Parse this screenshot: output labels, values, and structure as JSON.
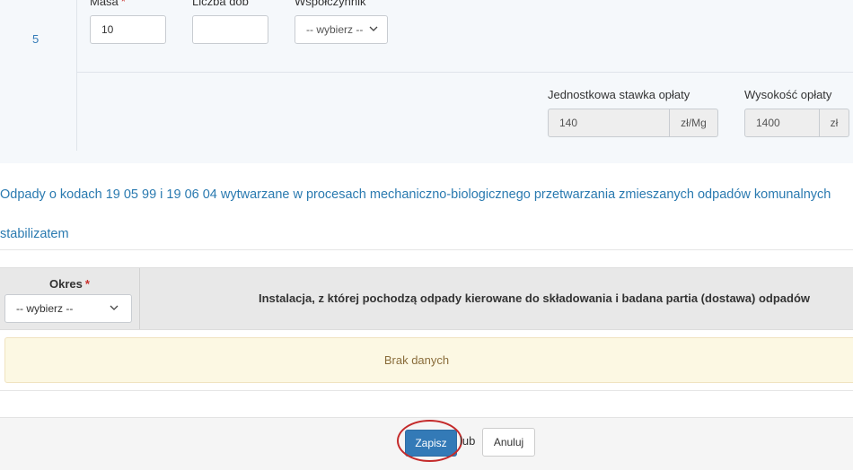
{
  "row": {
    "number": "5",
    "fields": {
      "mass": {
        "label": "Masa",
        "required_mark": "*",
        "value": "10"
      },
      "days": {
        "label": "Liczba dób",
        "value": ""
      },
      "coefficient": {
        "label": "Współczynnik",
        "selected": "-- wybierz --"
      }
    },
    "fee_rate": {
      "label": "Jednostkowa stawka opłaty",
      "value": "140",
      "unit": "zł/Mg"
    },
    "fee_amount": {
      "label": "Wysokość opłaty",
      "value": "1400",
      "unit": "zł"
    }
  },
  "waste_description": {
    "line1": "Odpady o kodach 19 05 99 i 19 06 04 wytwarzane w procesach mechaniczno-biologicznego przetwarzania zmieszanych odpadów komunalnych",
    "line2": "stabilizatem"
  },
  "table": {
    "period": {
      "label": "Okres",
      "required_mark": "*",
      "selected": "-- wybierz --"
    },
    "installation_header": "Instalacja, z której pochodzą odpady kierowane do składowania i badana partia (dostawa) odpadów",
    "empty_message": "Brak danych"
  },
  "footer": {
    "save_label": "Zapisz",
    "or_label": "lub",
    "cancel_label": "Anuluj"
  },
  "colors": {
    "primary": "#337ab7",
    "highlight_circle": "#c42a2a",
    "no_data_bg": "#fcf8e3"
  }
}
